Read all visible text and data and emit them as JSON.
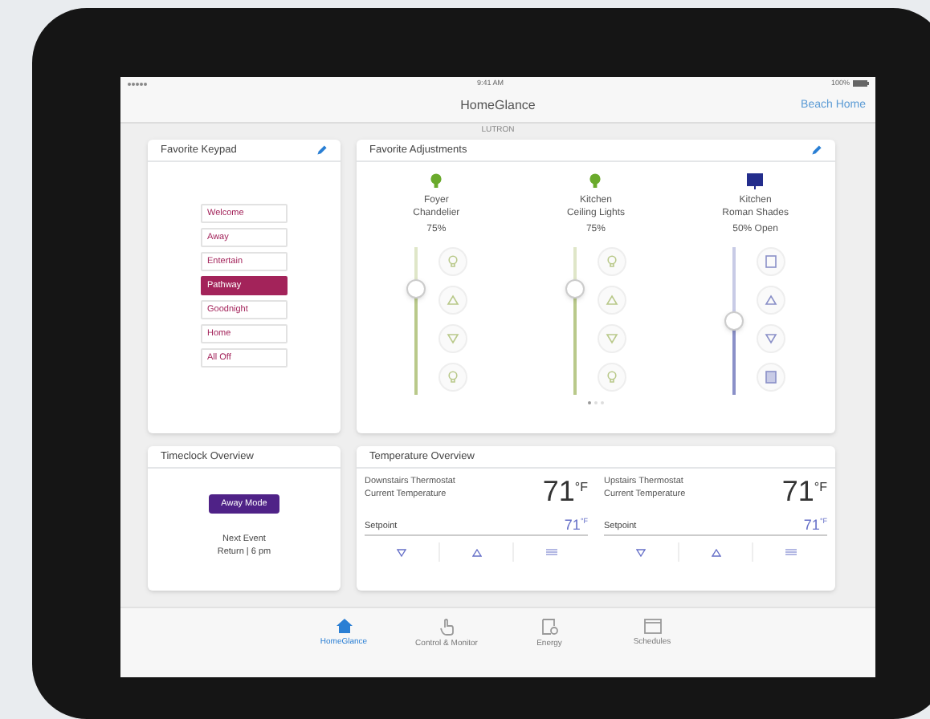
{
  "status_bar": {
    "time": "9:41 AM",
    "battery": "100%"
  },
  "nav": {
    "title": "HomeGlance",
    "location": "Beach Home",
    "brand": "LUTRON"
  },
  "keypad": {
    "title": "Favorite Keypad",
    "buttons": [
      {
        "label": "Welcome",
        "selected": false
      },
      {
        "label": "Away",
        "selected": false
      },
      {
        "label": "Entertain",
        "selected": false
      },
      {
        "label": "Pathway",
        "selected": true
      },
      {
        "label": "Goodnight",
        "selected": false
      },
      {
        "label": "Home",
        "selected": false
      },
      {
        "label": "All Off",
        "selected": false
      }
    ]
  },
  "adjustments": {
    "title": "Favorite Adjustments",
    "devices": [
      {
        "kind": "light",
        "name": "Foyer\nChandelier",
        "reading": "75%",
        "level": 0.75
      },
      {
        "kind": "light",
        "name": "Kitchen\nCeiling Lights",
        "reading": "75%",
        "level": 0.75
      },
      {
        "kind": "shade",
        "name": "Kitchen\nRoman Shades",
        "reading": "50% Open",
        "level": 0.5
      }
    ],
    "pages": [
      {
        "selected": true
      },
      {
        "selected": false
      },
      {
        "selected": false
      }
    ]
  },
  "timeclock": {
    "title": "Timeclock Overview",
    "mode": "Away Mode",
    "next_label": "Next Event",
    "next_event": "Return | 6 pm"
  },
  "temperature": {
    "title": "Temperature Overview",
    "thermostats": [
      {
        "name": "Downstairs Thermostat",
        "label": "Current Temperature",
        "current": "71",
        "unit": "°F",
        "setpoint_label": "Setpoint",
        "setpoint": "71",
        "setpoint_unit": "°F"
      },
      {
        "name": "Upstairs Thermostat",
        "label": "Current Temperature",
        "current": "71",
        "unit": "°F",
        "setpoint_label": "Setpoint",
        "setpoint": "71",
        "setpoint_unit": "°F"
      }
    ]
  },
  "tabs": [
    {
      "label": "HomeGlance",
      "kind": "home",
      "selected": true
    },
    {
      "label": "Control & Monitor",
      "kind": "hand",
      "selected": false
    },
    {
      "label": "Energy",
      "kind": "energy",
      "selected": false
    },
    {
      "label": "Schedules",
      "kind": "calendar",
      "selected": false
    }
  ]
}
